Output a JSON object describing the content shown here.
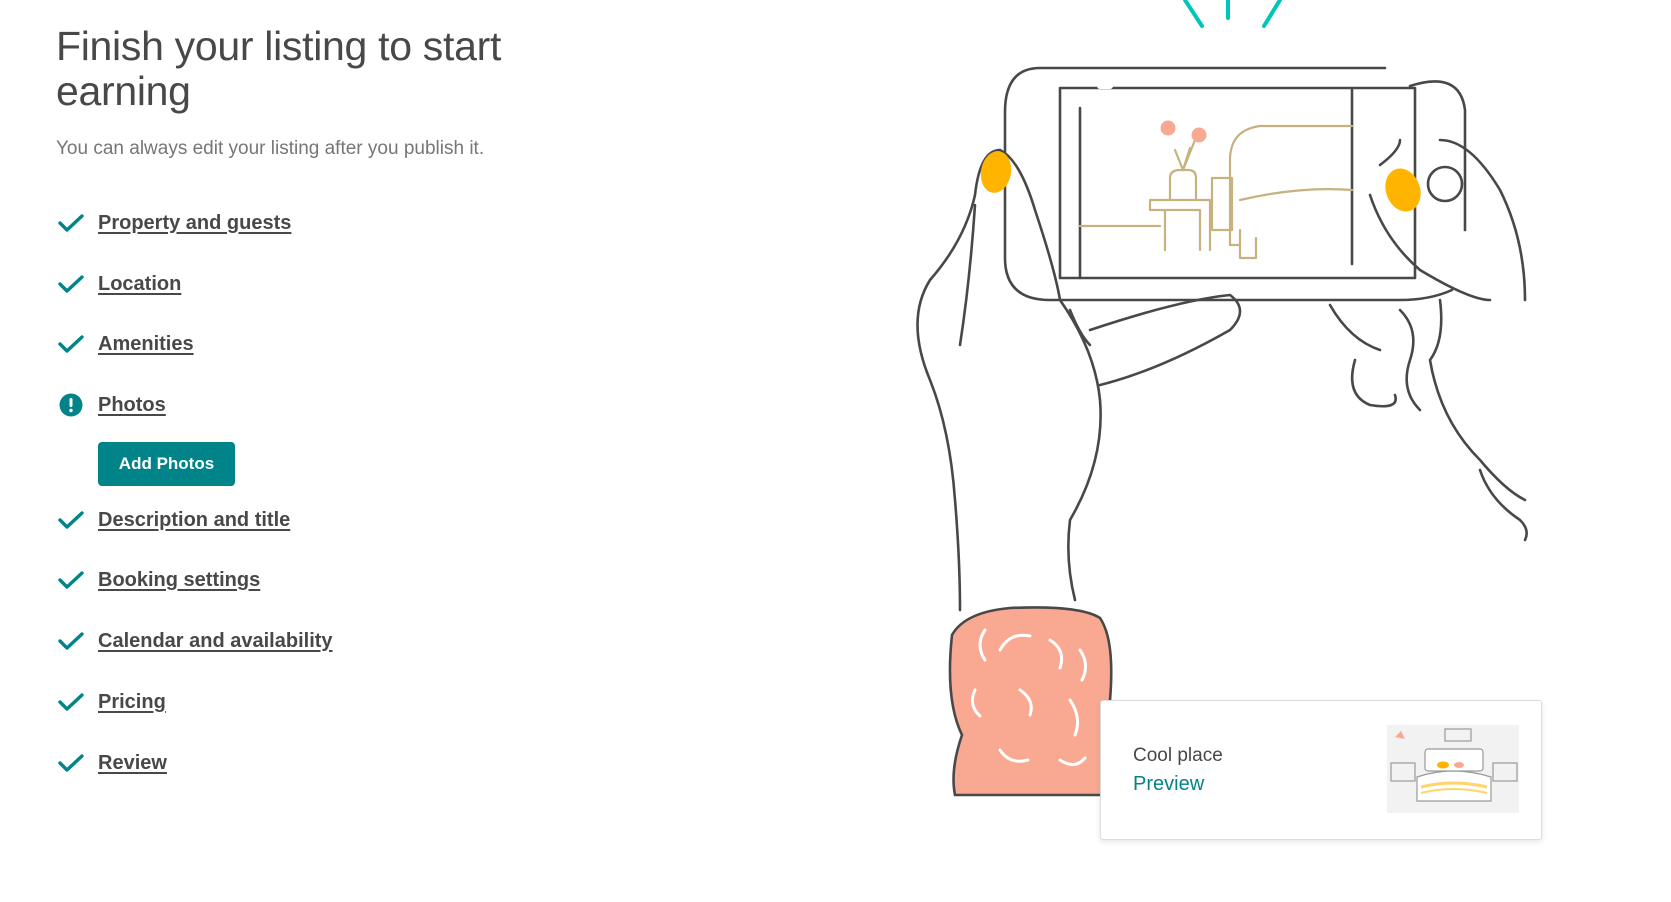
{
  "header": {
    "title": "Finish your listing to start earning",
    "subtitle": "You can always edit your listing after you publish it."
  },
  "steps": [
    {
      "label": "Property and guests",
      "status": "complete",
      "icon": "check-icon"
    },
    {
      "label": "Location",
      "status": "complete",
      "icon": "check-icon"
    },
    {
      "label": "Amenities",
      "status": "complete",
      "icon": "check-icon"
    },
    {
      "label": "Photos",
      "status": "incomplete",
      "icon": "alert-icon",
      "action_label": "Add Photos"
    },
    {
      "label": "Description and title",
      "status": "complete",
      "icon": "check-icon"
    },
    {
      "label": "Booking settings",
      "status": "complete",
      "icon": "check-icon"
    },
    {
      "label": "Calendar and availability",
      "status": "complete",
      "icon": "check-icon"
    },
    {
      "label": "Pricing",
      "status": "complete",
      "icon": "check-icon"
    },
    {
      "label": "Review",
      "status": "complete",
      "icon": "check-icon"
    }
  ],
  "preview": {
    "name": "Cool place",
    "link_label": "Preview"
  },
  "colors": {
    "accent": "#008489",
    "text": "#484848",
    "muted": "#767676",
    "nail": "#FFB400",
    "sleeve": "#F9A992",
    "furniture": "#C6B27E",
    "sparkle": "#00C6B8"
  }
}
